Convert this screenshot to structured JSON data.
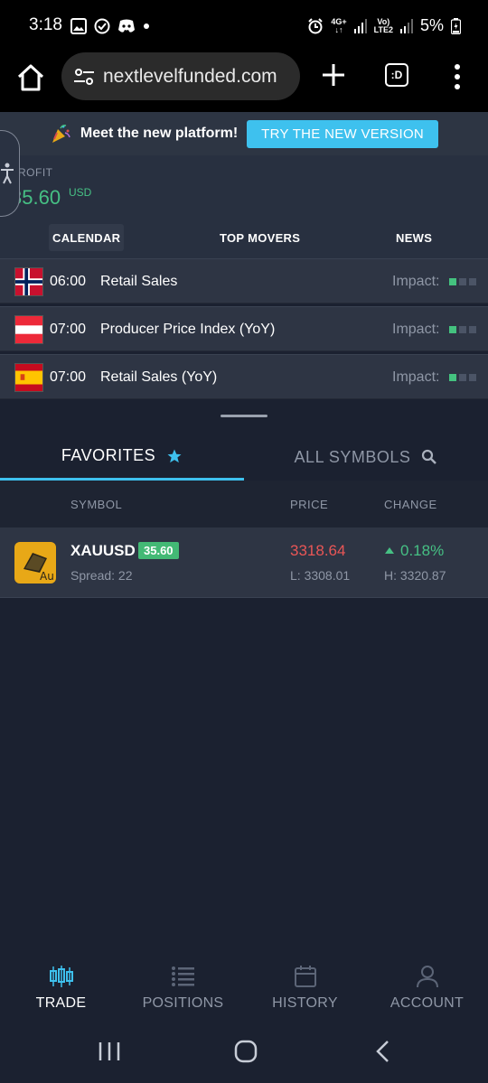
{
  "status_bar": {
    "time": "3:18",
    "network_top": "4G+",
    "volte_top": "Vo)",
    "volte_bottom": "LTE2",
    "battery": "5%"
  },
  "browser": {
    "url": "nextlevelfunded.com",
    "tabs_label": ":D"
  },
  "banner": {
    "text": "Meet the new platform!",
    "button": "TRY THE NEW VERSION"
  },
  "profit": {
    "label": "ROFIT",
    "value": "35.60",
    "unit": "USD"
  },
  "calendar_tabs": [
    {
      "label": "CALENDAR"
    },
    {
      "label": "TOP MOVERS"
    },
    {
      "label": "NEWS"
    }
  ],
  "events": [
    {
      "time": "06:00",
      "name": "Retail Sales",
      "impact_label": "Impact:",
      "impact_level": 1
    },
    {
      "time": "07:00",
      "name": "Producer Price Index (YoY)",
      "impact_label": "Impact:",
      "impact_level": 1
    },
    {
      "time": "07:00",
      "name": "Retail Sales (YoY)",
      "impact_label": "Impact:",
      "impact_level": 1
    }
  ],
  "symbol_tabs": {
    "favorites": "FAVORITES",
    "all": "ALL SYMBOLS"
  },
  "table": {
    "headers": {
      "symbol": "SYMBOL",
      "price": "PRICE",
      "change": "CHANGE"
    },
    "rows": [
      {
        "icon_text": "Au",
        "symbol": "XAUUSD",
        "badge": "35.60",
        "spread": "Spread: 22",
        "price": "3318.64",
        "low": "L: 3308.01",
        "change": "0.18%",
        "high": "H: 3320.87"
      }
    ]
  },
  "bottom_nav": [
    {
      "label": "TRADE"
    },
    {
      "label": "POSITIONS"
    },
    {
      "label": "HISTORY"
    },
    {
      "label": "ACCOUNT"
    }
  ],
  "colors": {
    "accent": "#3ec1ee",
    "positive": "#46c084",
    "negative": "#e95656",
    "background": "#1b2130"
  }
}
